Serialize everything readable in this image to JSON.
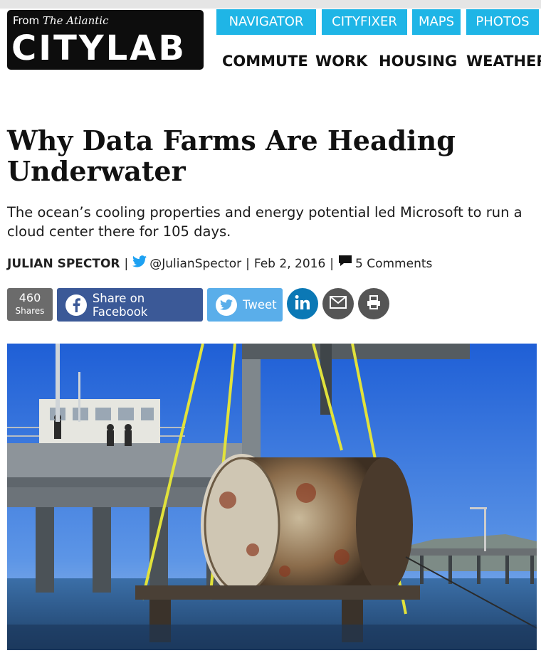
{
  "header": {
    "logo_from": "From ",
    "logo_publication": "The Atlantic",
    "logo_word": "CITYLAB",
    "nav": [
      "NAVIGATOR",
      "CITYFIXER",
      "MAPS",
      "PHOTOS"
    ],
    "subnav": [
      "COMMUTE",
      "WORK",
      "HOUSING",
      "WEATHER"
    ],
    "accent_color": "#1fb5e6"
  },
  "article": {
    "title": "Why Data Farms Are Heading Underwater",
    "dek": "The ocean’s cooling properties and energy potential led Microsoft to run a cloud center there for 105 days.",
    "author": "JULIAN SPECTOR",
    "twitter_handle": "@JulianSpector",
    "date": "Feb 2, 2016",
    "comments": "5 Comments"
  },
  "share": {
    "count": "460",
    "count_label": "Shares",
    "facebook_label": "Share on Facebook",
    "tweet_label": "Tweet",
    "icons": [
      "facebook-icon",
      "twitter-icon",
      "linkedin-icon",
      "email-icon",
      "print-icon"
    ],
    "colors": {
      "facebook": "#3b5997",
      "twitter": "#5aaeea",
      "linkedin": "#0b78b5",
      "neutral": "#555555"
    }
  },
  "photo": {
    "subject": "cylindrical data center vessel lifted from the sea by a crane beside a pier"
  }
}
